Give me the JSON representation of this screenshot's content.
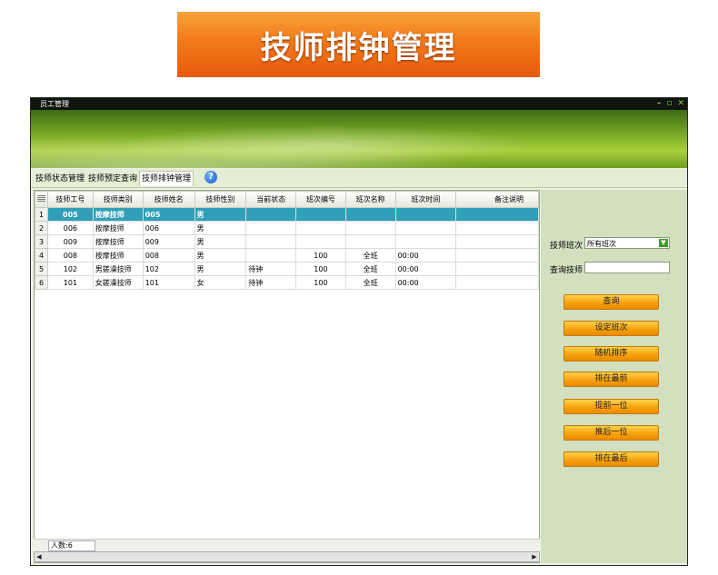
{
  "banner": {
    "title": "技师排钟管理"
  },
  "window": {
    "title": "员工管理",
    "controls": {
      "minimize": "–",
      "restore": "▫",
      "close": "✕"
    }
  },
  "tabs": [
    "技师状态管理",
    "技师预定查询",
    "技师排钟管理"
  ],
  "help": {
    "glyph": "?"
  },
  "grid": {
    "columns": [
      "技师工号",
      "技师类别",
      "技师姓名",
      "技师性别",
      "当前状态",
      "班次编号",
      "班次名称",
      "班次时间",
      "备注说明"
    ],
    "rows": [
      {
        "n": "1",
        "cells": [
          "005",
          "按摩技师",
          "005",
          "男",
          "",
          "",
          "",
          "",
          ""
        ]
      },
      {
        "n": "2",
        "cells": [
          "006",
          "按摩技师",
          "006",
          "男",
          "",
          "",
          "",
          "",
          ""
        ]
      },
      {
        "n": "3",
        "cells": [
          "009",
          "按摩技师",
          "009",
          "男",
          "",
          "",
          "",
          "",
          ""
        ]
      },
      {
        "n": "4",
        "cells": [
          "008",
          "按摩技师",
          "008",
          "男",
          "",
          "100",
          "全班",
          "00:00",
          ""
        ]
      },
      {
        "n": "5",
        "cells": [
          "102",
          "男搓澡技师",
          "102",
          "男",
          "待钟",
          "100",
          "全班",
          "00:00",
          ""
        ]
      },
      {
        "n": "6",
        "cells": [
          "101",
          "女搓澡技师",
          "101",
          "女",
          "待钟",
          "100",
          "全班",
          "00:00",
          ""
        ]
      }
    ],
    "selected_row": 0,
    "footer": "人数:6"
  },
  "panel": {
    "shift_label": "技师班次",
    "shift_value": "所有班次",
    "search_label": "查询技师",
    "search_value": "",
    "buttons": [
      "查询",
      "设定班次",
      "随机排序",
      "排在最前",
      "提前一位",
      "推后一位",
      "排在最后"
    ]
  }
}
